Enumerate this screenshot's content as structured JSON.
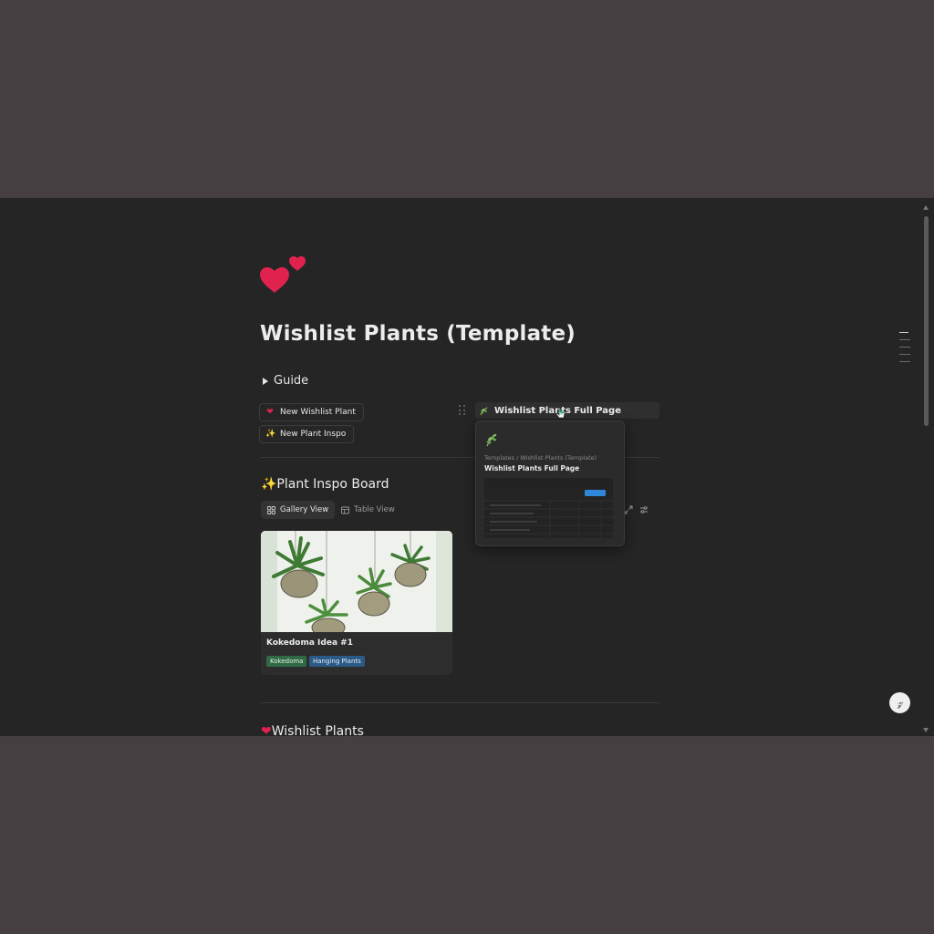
{
  "page": {
    "title": "Wishlist Plants (Template)",
    "icon": "two-hearts-icon"
  },
  "guide": {
    "label": "Guide"
  },
  "buttons": {
    "new_wishlist_plant": {
      "label": "New Wishlist Plant",
      "icon": "heart-icon"
    },
    "new_plant_inspo": {
      "label": "New Plant Inspo",
      "icon": "sparkles-icon"
    }
  },
  "linked_page": {
    "label": "Wishlist Plants Full Page",
    "icon": "herb-icon"
  },
  "hover_preview": {
    "breadcrumb_1": "Templates",
    "separator": "/",
    "breadcrumb_2": "Wishlist Plants (Template)",
    "title": "Wishlist Plants Full Page"
  },
  "inspo_board": {
    "title": "✨Plant Inspo Board",
    "views": [
      {
        "label": "Gallery View",
        "active": true
      },
      {
        "label": "Table View",
        "active": false
      }
    ],
    "cards": [
      {
        "title": "Kokedoma Idea #1",
        "tags": [
          "Kokedoma",
          "Hanging Plants"
        ]
      }
    ]
  },
  "next_section": {
    "title": "Wishlist Plants"
  },
  "colors": {
    "background": "#252525",
    "heart": "#e0234e",
    "tag_green": "#2f6a45",
    "tag_blue": "#2b5a86"
  }
}
